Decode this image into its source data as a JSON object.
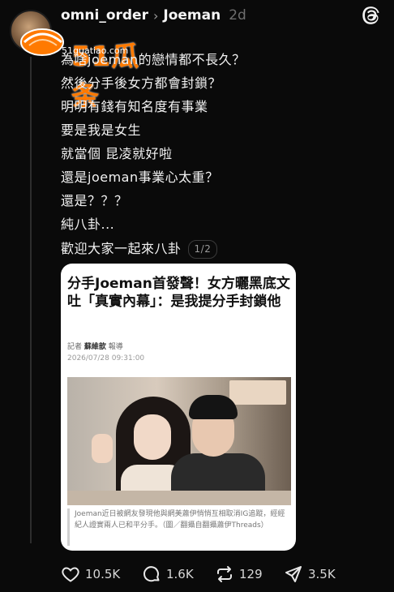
{
  "post": {
    "username": "omni_order",
    "reply_to": "Joeman",
    "time_ago": "2d",
    "lines": [
      "女方",
      "為啥joeman的戀情都不長久？",
      "然後分手後女方都會封鎖？",
      "明明有錢有知名度有事業",
      "要是我是女生",
      "就當個 昆凌就好啦",
      "還是joeman事業心太重？",
      "還是？？？",
      "純八卦...",
      "歡迎大家一起來八卦"
    ],
    "pager": "1/2"
  },
  "watermark": {
    "logo_text": "51瓜条",
    "url": "51guatiao.com"
  },
  "article": {
    "title": "分手Joeman首發聲！女方曬黑底文吐「真實內幕」：是我提分手封鎖他",
    "byline_prefix": "記者",
    "author": "蘇維歆",
    "byline_suffix": "報導",
    "datetime": "2026/07/28 09:31:00",
    "caption": "Joeman近日被網友發現他與網美蕭伊悄悄互相取消IG追蹤，經經紀人證實兩人已和平分手。（圖／翻攝自翻攝蕭伊Threads）"
  },
  "actions": {
    "likes": "10.5K",
    "comments": "1.6K",
    "reposts": "129",
    "shares": "3.5K"
  },
  "icons": [
    "threads-icon",
    "heart-icon",
    "comment-icon",
    "repost-icon",
    "share-icon"
  ],
  "colors": {
    "background": "#0a0a0a",
    "text": "#f2f2f2",
    "muted": "#6e6e6e",
    "watermark": "#ff7a00"
  }
}
